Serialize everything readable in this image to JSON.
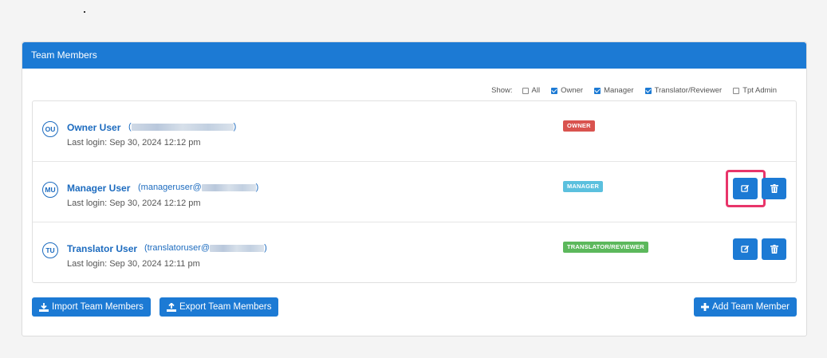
{
  "panel": {
    "title": "Team Members"
  },
  "filters": {
    "show_label": "Show:",
    "options": [
      {
        "label": "All",
        "checked": false
      },
      {
        "label": "Owner",
        "checked": true
      },
      {
        "label": "Manager",
        "checked": true
      },
      {
        "label": "Translator/Reviewer",
        "checked": true
      },
      {
        "label": "Tpt Admin",
        "checked": false
      }
    ]
  },
  "members": [
    {
      "initials": "OU",
      "name": "Owner User",
      "email_prefix": "(",
      "email_suffix": ")",
      "last_login": "Last login: Sep 30, 2024 12:12 pm",
      "role": "OWNER",
      "role_color": "#d9534f",
      "actions": false
    },
    {
      "initials": "MU",
      "name": "Manager User",
      "email_prefix": "(manageruser@",
      "email_suffix": ")",
      "last_login": "Last login: Sep 30, 2024 12:12 pm",
      "role": "MANAGER",
      "role_color": "#5bc0de",
      "actions": true
    },
    {
      "initials": "TU",
      "name": "Translator User",
      "email_prefix": "(translatoruser@",
      "email_suffix": ")",
      "last_login": "Last login: Sep 30, 2024 12:11 pm",
      "role": "TRANSLATOR/REVIEWER",
      "role_color": "#5cb85c",
      "actions": true
    }
  ],
  "buttons": {
    "import": "Import Team Members",
    "export": "Export Team Members",
    "add": "Add Team Member"
  },
  "icons": {
    "edit": "edit-icon",
    "delete": "trash-icon",
    "import": "import-icon",
    "export": "export-icon",
    "add": "plus-icon"
  },
  "colors": {
    "accent": "#1c7ad4",
    "highlight": "#e8356a"
  }
}
